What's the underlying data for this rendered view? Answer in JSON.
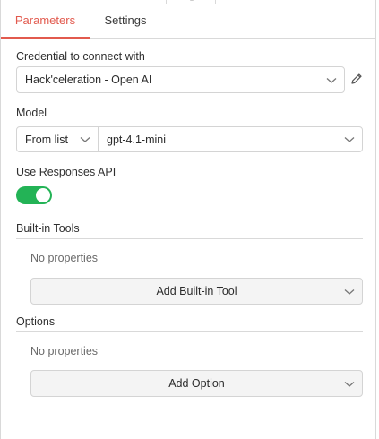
{
  "tabs": [
    {
      "label": "Parameters",
      "active": true
    },
    {
      "label": "Settings",
      "active": false
    }
  ],
  "credential": {
    "label": "Credential to connect with",
    "value": "Hack'celeration - Open AI",
    "edit_icon": "pencil-icon"
  },
  "model": {
    "label": "Model",
    "mode_value": "From list",
    "value": "gpt-4.1-mini"
  },
  "responses_api": {
    "label": "Use Responses API",
    "enabled": true
  },
  "builtin_tools": {
    "title": "Built-in Tools",
    "empty_text": "No properties",
    "add_label": "Add Built-in Tool"
  },
  "options": {
    "title": "Options",
    "empty_text": "No properties",
    "add_label": "Add Option"
  },
  "colors": {
    "accent": "#e25a4e",
    "toggle_on": "#23b356"
  }
}
